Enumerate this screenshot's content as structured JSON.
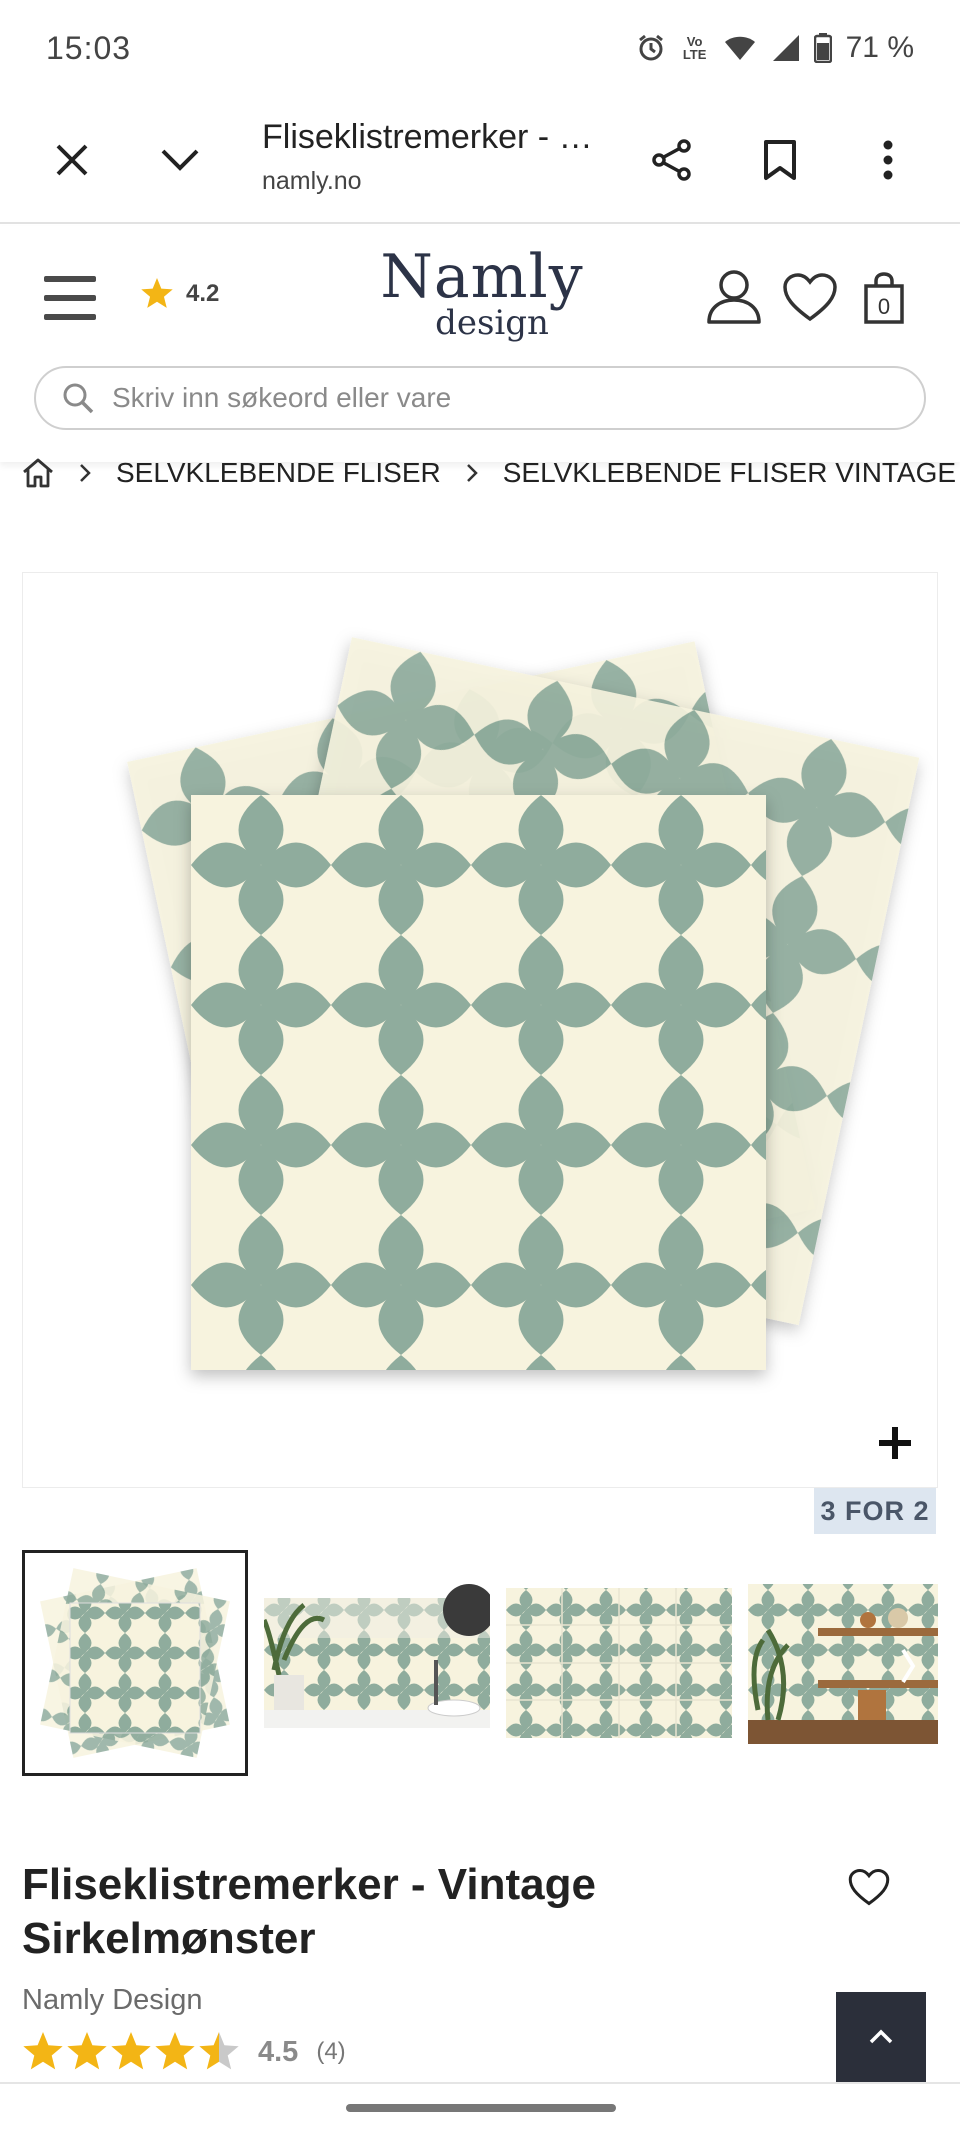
{
  "status_bar": {
    "time": "15:03",
    "volte": "Vo LTE",
    "battery": "71 %"
  },
  "browser_bar": {
    "title": "Fliseklistremerker - Vintage Sirkelmønster",
    "url": "namly.no"
  },
  "header": {
    "store_rating": "4.2",
    "logo_line1": "Namly",
    "logo_line2": "design",
    "cart_count": "0",
    "search_placeholder": "Skriv inn søkeord eller vare"
  },
  "breadcrumb": {
    "items": [
      "SELVKLEBENDE FLISER",
      "SELVKLEBENDE FLISER VINTAGE"
    ]
  },
  "gallery": {
    "promo_badge": "3 FOR 2",
    "thumbnail_count": 4,
    "active_index": 0
  },
  "product": {
    "title": "Fliseklistremerker - Vintage Sirkelmønster",
    "brand": "Namly Design",
    "rating": "4.5",
    "rating_value": 4.5,
    "review_count": "(4)"
  },
  "colors": {
    "tile_green": "#8fac9d",
    "tile_cream": "#f7f3de",
    "star": "#f3b515",
    "dark_button": "#2b2f3a",
    "promo_bg": "#dde6f0"
  }
}
